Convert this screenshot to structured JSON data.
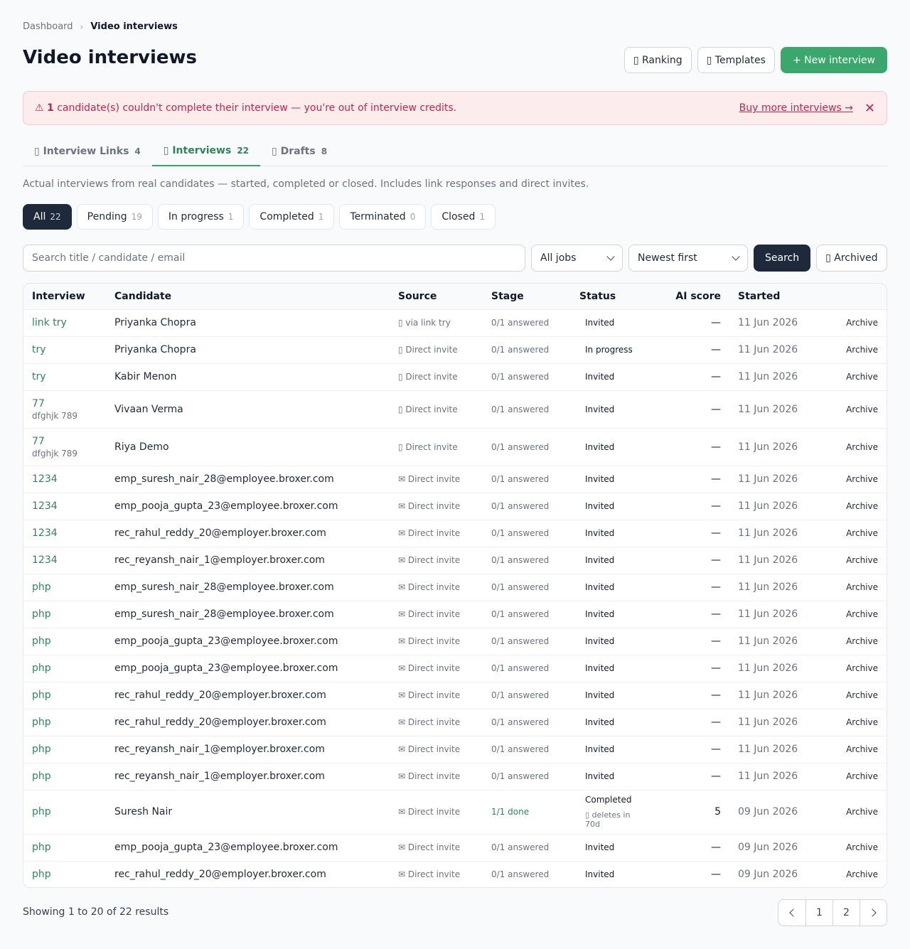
{
  "breadcrumb": {
    "parent": "Dashboard",
    "current": "Video interviews"
  },
  "header": {
    "title": "Video interviews",
    "ranking_label": "▯ Ranking",
    "templates_label": "▯ Templates",
    "new_label": "+ New interview"
  },
  "alert": {
    "icon": "⚠",
    "count": "1",
    "message": " candidate(s) couldn't complete their interview — you're out of interview credits.",
    "link": "Buy more interviews →",
    "close": "✕"
  },
  "tabs": [
    {
      "label": "▯ Interview Links",
      "count": "4"
    },
    {
      "label": "▯ Interviews",
      "count": "22"
    },
    {
      "label": "▯ Drafts",
      "count": "8"
    }
  ],
  "description": "Actual interviews from real candidates — started, completed or closed. Includes link responses and direct invites.",
  "filters": [
    {
      "label": "All",
      "count": "22"
    },
    {
      "label": "Pending",
      "count": "19"
    },
    {
      "label": "In progress",
      "count": "1"
    },
    {
      "label": "Completed",
      "count": "1"
    },
    {
      "label": "Terminated",
      "count": "0"
    },
    {
      "label": "Closed",
      "count": "1"
    }
  ],
  "search": {
    "placeholder": "Search title / candidate / email",
    "jobs": "All jobs",
    "sort": "Newest first",
    "search_label": "Search",
    "archived_label": "▯ Archived"
  },
  "columns": [
    "Interview",
    "Candidate",
    "Source",
    "Stage",
    "Status",
    "AI score",
    "Started"
  ],
  "rows": [
    {
      "interview": "link try",
      "sub": "",
      "candidate": "Priyanka Chopra",
      "source": "▯ via link try",
      "stage": "0/1 answered",
      "status": "Invited",
      "note": "",
      "score": "—",
      "started": "11 Jun 2026",
      "action": "Archive"
    },
    {
      "interview": "try",
      "sub": "",
      "candidate": "Priyanka Chopra",
      "source": "▯ Direct invite",
      "stage": "0/1 answered",
      "status": "In progress",
      "note": "",
      "score": "—",
      "started": "11 Jun 2026",
      "action": "Archive"
    },
    {
      "interview": "try",
      "sub": "",
      "candidate": "Kabir Menon",
      "source": "▯ Direct invite",
      "stage": "0/1 answered",
      "status": "Invited",
      "note": "",
      "score": "—",
      "started": "11 Jun 2026",
      "action": "Archive"
    },
    {
      "interview": "77",
      "sub": "dfghjk 789",
      "candidate": "Vivaan Verma",
      "source": "▯ Direct invite",
      "stage": "0/1 answered",
      "status": "Invited",
      "note": "",
      "score": "—",
      "started": "11 Jun 2026",
      "action": "Archive"
    },
    {
      "interview": "77",
      "sub": "dfghjk 789",
      "candidate": "Riya Demo",
      "source": "▯ Direct invite",
      "stage": "0/1 answered",
      "status": "Invited",
      "note": "",
      "score": "—",
      "started": "11 Jun 2026",
      "action": "Archive"
    },
    {
      "interview": "1234",
      "sub": "",
      "candidate": "emp_suresh_nair_28@employee.broxer.com",
      "source": "✉ Direct invite",
      "stage": "0/1 answered",
      "status": "Invited",
      "note": "",
      "score": "—",
      "started": "11 Jun 2026",
      "action": "Archive"
    },
    {
      "interview": "1234",
      "sub": "",
      "candidate": "emp_pooja_gupta_23@employee.broxer.com",
      "source": "✉ Direct invite",
      "stage": "0/1 answered",
      "status": "Invited",
      "note": "",
      "score": "—",
      "started": "11 Jun 2026",
      "action": "Archive"
    },
    {
      "interview": "1234",
      "sub": "",
      "candidate": "rec_rahul_reddy_20@employer.broxer.com",
      "source": "✉ Direct invite",
      "stage": "0/1 answered",
      "status": "Invited",
      "note": "",
      "score": "—",
      "started": "11 Jun 2026",
      "action": "Archive"
    },
    {
      "interview": "1234",
      "sub": "",
      "candidate": "rec_reyansh_nair_1@employer.broxer.com",
      "source": "✉ Direct invite",
      "stage": "0/1 answered",
      "status": "Invited",
      "note": "",
      "score": "—",
      "started": "11 Jun 2026",
      "action": "Archive"
    },
    {
      "interview": "php",
      "sub": "",
      "candidate": "emp_suresh_nair_28@employee.broxer.com",
      "source": "✉ Direct invite",
      "stage": "0/1 answered",
      "status": "Invited",
      "note": "",
      "score": "—",
      "started": "11 Jun 2026",
      "action": "Archive"
    },
    {
      "interview": "php",
      "sub": "",
      "candidate": "emp_suresh_nair_28@employee.broxer.com",
      "source": "✉ Direct invite",
      "stage": "0/1 answered",
      "status": "Invited",
      "note": "",
      "score": "—",
      "started": "11 Jun 2026",
      "action": "Archive"
    },
    {
      "interview": "php",
      "sub": "",
      "candidate": "emp_pooja_gupta_23@employee.broxer.com",
      "source": "✉ Direct invite",
      "stage": "0/1 answered",
      "status": "Invited",
      "note": "",
      "score": "—",
      "started": "11 Jun 2026",
      "action": "Archive"
    },
    {
      "interview": "php",
      "sub": "",
      "candidate": "emp_pooja_gupta_23@employee.broxer.com",
      "source": "✉ Direct invite",
      "stage": "0/1 answered",
      "status": "Invited",
      "note": "",
      "score": "—",
      "started": "11 Jun 2026",
      "action": "Archive"
    },
    {
      "interview": "php",
      "sub": "",
      "candidate": "rec_rahul_reddy_20@employer.broxer.com",
      "source": "✉ Direct invite",
      "stage": "0/1 answered",
      "status": "Invited",
      "note": "",
      "score": "—",
      "started": "11 Jun 2026",
      "action": "Archive"
    },
    {
      "interview": "php",
      "sub": "",
      "candidate": "rec_rahul_reddy_20@employer.broxer.com",
      "source": "✉ Direct invite",
      "stage": "0/1 answered",
      "status": "Invited",
      "note": "",
      "score": "—",
      "started": "11 Jun 2026",
      "action": "Archive"
    },
    {
      "interview": "php",
      "sub": "",
      "candidate": "rec_reyansh_nair_1@employer.broxer.com",
      "source": "✉ Direct invite",
      "stage": "0/1 answered",
      "status": "Invited",
      "note": "",
      "score": "—",
      "started": "11 Jun 2026",
      "action": "Archive"
    },
    {
      "interview": "php",
      "sub": "",
      "candidate": "rec_reyansh_nair_1@employer.broxer.com",
      "source": "✉ Direct invite",
      "stage": "0/1 answered",
      "status": "Invited",
      "note": "",
      "score": "—",
      "started": "11 Jun 2026",
      "action": "Archive"
    },
    {
      "interview": "php",
      "sub": "",
      "candidate": "Suresh Nair",
      "source": "✉ Direct invite",
      "stage": "1/1 done",
      "status": "Completed",
      "note": "▯ deletes in 70d",
      "score": "5",
      "started": "09 Jun 2026",
      "action": "Archive"
    },
    {
      "interview": "php",
      "sub": "",
      "candidate": "emp_pooja_gupta_23@employee.broxer.com",
      "source": "✉ Direct invite",
      "stage": "0/1 answered",
      "status": "Invited",
      "note": "",
      "score": "—",
      "started": "09 Jun 2026",
      "action": "Archive"
    },
    {
      "interview": "php",
      "sub": "",
      "candidate": "rec_rahul_reddy_20@employer.broxer.com",
      "source": "✉ Direct invite",
      "stage": "0/1 answered",
      "status": "Invited",
      "note": "",
      "score": "—",
      "started": "09 Jun 2026",
      "action": "Archive"
    }
  ],
  "footer": {
    "showing": "Showing 1 to 20 of 22 results",
    "pages": [
      "1",
      "2"
    ]
  },
  "colors": {
    "accent": "#3aa76d",
    "dark": "#1e293b",
    "alert_text": "#c0264b"
  }
}
